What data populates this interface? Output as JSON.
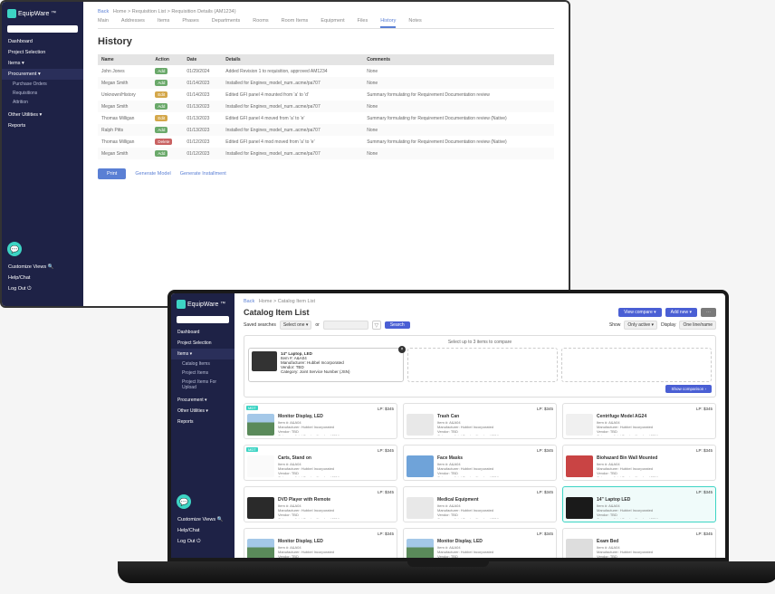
{
  "brand": "EquipWare",
  "monitor": {
    "crumb_back": "Back",
    "crumb": "Home > Requisition List > Requisition Details (AM1234)",
    "tabs": [
      "Main",
      "Addresses",
      "Items",
      "Phases",
      "Departments",
      "Rooms",
      "Room Items",
      "Equipment",
      "Files",
      "History",
      "Notes"
    ],
    "active_tab": 9,
    "title": "History",
    "cols": [
      "Name",
      "Action",
      "Date",
      "Details",
      "Comments"
    ],
    "rows": [
      {
        "name": "John Jones",
        "act": "Add",
        "act_class": "b-add",
        "date": "01/29/2024",
        "details": "Added Revision 1 to requisition, approved AM1234",
        "comm": "None"
      },
      {
        "name": "Megan Smith",
        "act": "Add",
        "act_class": "b-add",
        "date": "01/14/2023",
        "details": "Installed for Engines_model_num..acme/pa707",
        "comm": "None"
      },
      {
        "name": "Unknown/History",
        "act": "Edit",
        "act_class": "b-edit",
        "date": "01/14/2023",
        "details": "Edited GFI panel 4 mounted from 'a' to 'd'",
        "comm": "Summary formulating for Requirement Documentation review"
      },
      {
        "name": "Megan Smith",
        "act": "Add",
        "act_class": "b-add",
        "date": "01/13/2023",
        "details": "Installed for Engines_model_num..acme/pa707",
        "comm": "None"
      },
      {
        "name": "Thomas Milligan",
        "act": "Edit",
        "act_class": "b-edit",
        "date": "01/13/2023",
        "details": "Edited GFI panel 4 moved from 'a' to 'e'",
        "comm": "Summary formulating for Requirement Documentation review (Native)"
      },
      {
        "name": "Ralph Pitts",
        "act": "Add",
        "act_class": "b-add",
        "date": "01/13/2023",
        "details": "Installed for Engines_model_num..acme/pa707",
        "comm": "None"
      },
      {
        "name": "Thomas Milligan",
        "act": "Delete",
        "act_class": "b-del",
        "date": "01/12/2023",
        "details": "Edited GFI panel 4 mod moved from 'a' to 'e'",
        "comm": "Summary formulating for Requirement Documentation review (Native)"
      },
      {
        "name": "Megan Smith",
        "act": "Add",
        "act_class": "b-add",
        "date": "01/12/2023",
        "details": "Installed for Engines_model_num..acme/pa707",
        "comm": "None"
      }
    ],
    "btn_print": "Print",
    "btn_mod": "Generate Model",
    "btn_mod2": "Generate Installment",
    "sidebar": {
      "items": [
        "Dashboard",
        "Project Selection",
        "Items ▾",
        "Procurement ▾"
      ],
      "subs": [
        "Purchase Orders",
        "Requisitions",
        "Attrition"
      ],
      "items2": [
        "Other Utilities ▾",
        "Reports"
      ],
      "bottom": [
        "Customize Views 🔍",
        "Help/Chat",
        "Log Out ⏻"
      ]
    }
  },
  "laptop": {
    "crumb_back": "Back",
    "crumb": "Home > Catalog Item List",
    "title": "Catalog Item List",
    "head_btns": [
      "View compare ▾",
      "Add new ▾",
      "⋯"
    ],
    "saved_label": "Saved searches",
    "saved_sel": "Select one ▾",
    "or": "or",
    "search_ph": "Search",
    "btn_search": "Search",
    "show_label": "Show",
    "show_sel": "Only active ▾",
    "display_label": "Display",
    "display_sel": "One line/name",
    "compare_head": "Select up to 3 items to compare",
    "slot": {
      "title": "14\" Laptop, LED",
      "item_l": "Item #:",
      "item_v": "A&A04",
      "mfr_l": "Manufacturer:",
      "mfr_v": "Hubbel Incorporated",
      "ven_l": "Vendor:",
      "ven_v": "TBD",
      "cat_l": "Category:",
      "cat_v": "Joint Service Number (JSN)"
    },
    "show_comp": "Show comparison ›",
    "cards": [
      {
        "tag": "MDT",
        "title": "Monitor Display, LED",
        "price": "LP: $345",
        "img": "ci-monitor"
      },
      {
        "tag": "",
        "title": "Trash Can",
        "price": "LP: $345",
        "img": "ci-trash"
      },
      {
        "tag": "",
        "title": "Centrifuge Model AG24",
        "price": "LP: $345",
        "img": "ci-centrifuge"
      },
      {
        "tag": "MDT",
        "title": "Carts, Stand on",
        "price": "LP: $345",
        "img": "ci-cart"
      },
      {
        "tag": "",
        "title": "Face Masks",
        "price": "LP: $345",
        "img": "ci-mask"
      },
      {
        "tag": "",
        "title": "Biohazard Bin Wall Mounted",
        "price": "LP: $345",
        "img": "ci-sharps"
      },
      {
        "tag": "",
        "title": "DVD Player with Remote",
        "price": "LP: $345",
        "img": "ci-dvd"
      },
      {
        "tag": "",
        "title": "Medical Equipment",
        "price": "LP: $345",
        "img": "ci-med"
      },
      {
        "tag": "",
        "title": "14\" Laptop LED",
        "price": "LP: $345",
        "img": "ci-laptop",
        "sel": true
      },
      {
        "tag": "",
        "title": "Monitor Display, LED",
        "price": "LP: $345",
        "img": "ci-monitor"
      },
      {
        "tag": "",
        "title": "Monitor Display, LED",
        "price": "LP: $345",
        "img": "ci-monitor"
      },
      {
        "tag": "",
        "title": "Exam Bed",
        "price": "LP: $345",
        "img": ""
      }
    ],
    "card_meta": {
      "item_l": "Item #:",
      "item_v": "A&A04",
      "mfr_l": "Manufacturer:",
      "mfr_v": "Hubbel Incorporated",
      "ven_l": "Vendor:",
      "ven_v": "TBD",
      "cat_l": "Category:",
      "cat_v": "Joint Service Number (JSN)"
    },
    "sidebar": {
      "items": [
        "Dashboard",
        "Project Selection",
        "Items ▾"
      ],
      "subs": [
        "Catalog Items",
        "Project Items",
        "Project Items For Upload"
      ],
      "items2": [
        "Procurement ▾",
        "Other Utilities ▾",
        "Reports"
      ],
      "bottom": [
        "Customize Views 🔍",
        "Help/Chat",
        "Log Out ⏻"
      ]
    }
  }
}
